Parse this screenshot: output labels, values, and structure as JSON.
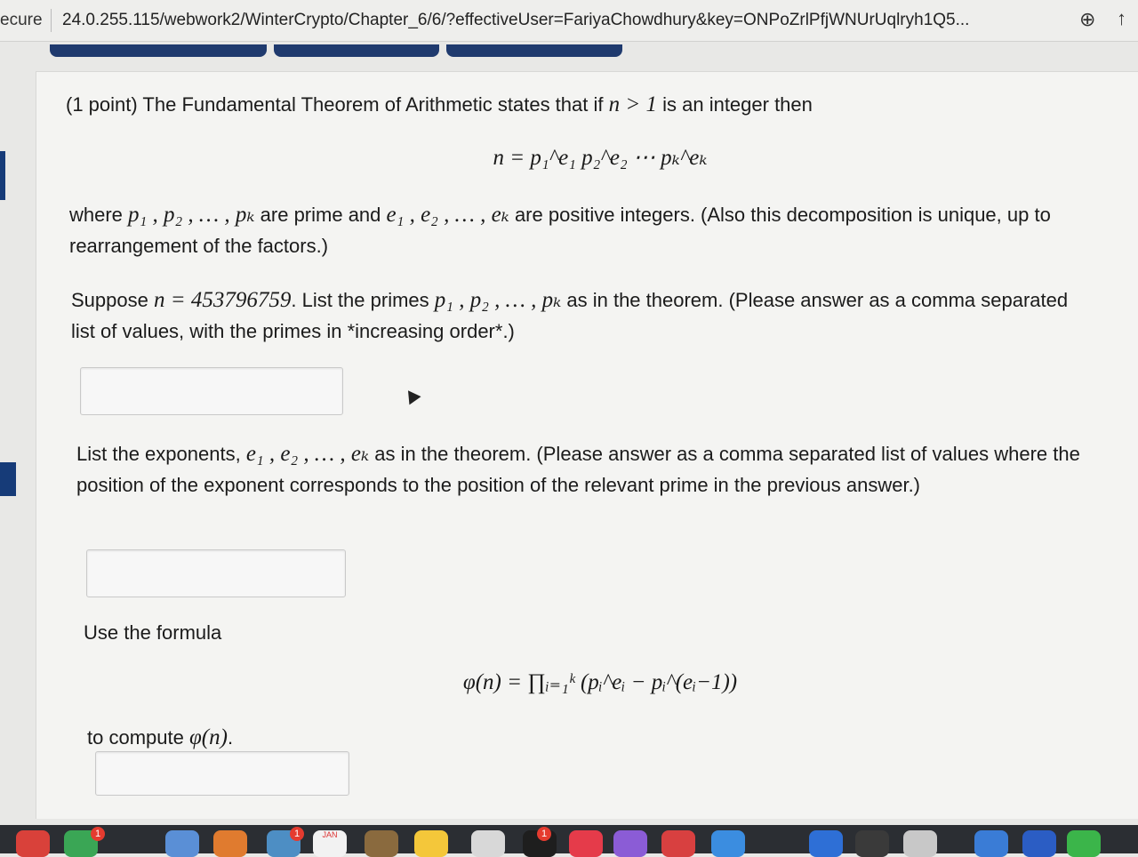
{
  "browser": {
    "secure_text": "ecure",
    "url": "24.0.255.115/webwork2/WinterCrypto/Chapter_6/6/?effectiveUser=FariyaChowdhury&key=ONPoZrlPfjWNUrUqlryh1Q5...",
    "zoom_icon": "zoom-icon",
    "share_icon": "share-icon"
  },
  "problem": {
    "intro_prefix": "(1 point) The Fundamental Theorem of Arithmetic states that if",
    "intro_math": "n > 1",
    "intro_suffix": "is an integer then",
    "formula1": "n = p₁^e₁ p₂^e₂ ⋯ pₖ^eₖ",
    "where_prefix": "where",
    "where_primes": "p₁ , p₂ , … , pₖ",
    "where_mid": "are prime and",
    "where_exps": "e₁ , e₂ , … , eₖ",
    "where_suffix": "are positive integers. (Also this decomposition is unique, up to rearrangement of the factors.)",
    "suppose_prefix": "Suppose",
    "suppose_math": "n = 453796759",
    "suppose_mid": ". List the primes",
    "suppose_primes": "p₁ , p₂ , … , pₖ",
    "suppose_suffix": "as in the theorem. (Please answer as a comma separated list of values, with the primes in *increasing order*.)",
    "exp_prefix": "List the exponents,",
    "exp_math": "e₁ , e₂ , … , eₖ",
    "exp_suffix": "as in the theorem. (Please answer as a comma separated list of values where the position of the exponent corresponds to the position of the relevant prime in the previous answer.)",
    "use_formula": "Use the formula",
    "formula2": "φ(n) = ∏ᵢ₌₁ᵏ (pᵢ^eᵢ − pᵢ^(eᵢ−1))",
    "compute_prefix": "to compute",
    "compute_math": "φ(n)",
    "compute_suffix": "."
  },
  "answers": {
    "primes": "",
    "exponents": "",
    "phi": ""
  },
  "dock": {
    "calendar_label": "JAN",
    "badge_1": "1",
    "badge_2": "1",
    "badge_3": "1"
  }
}
